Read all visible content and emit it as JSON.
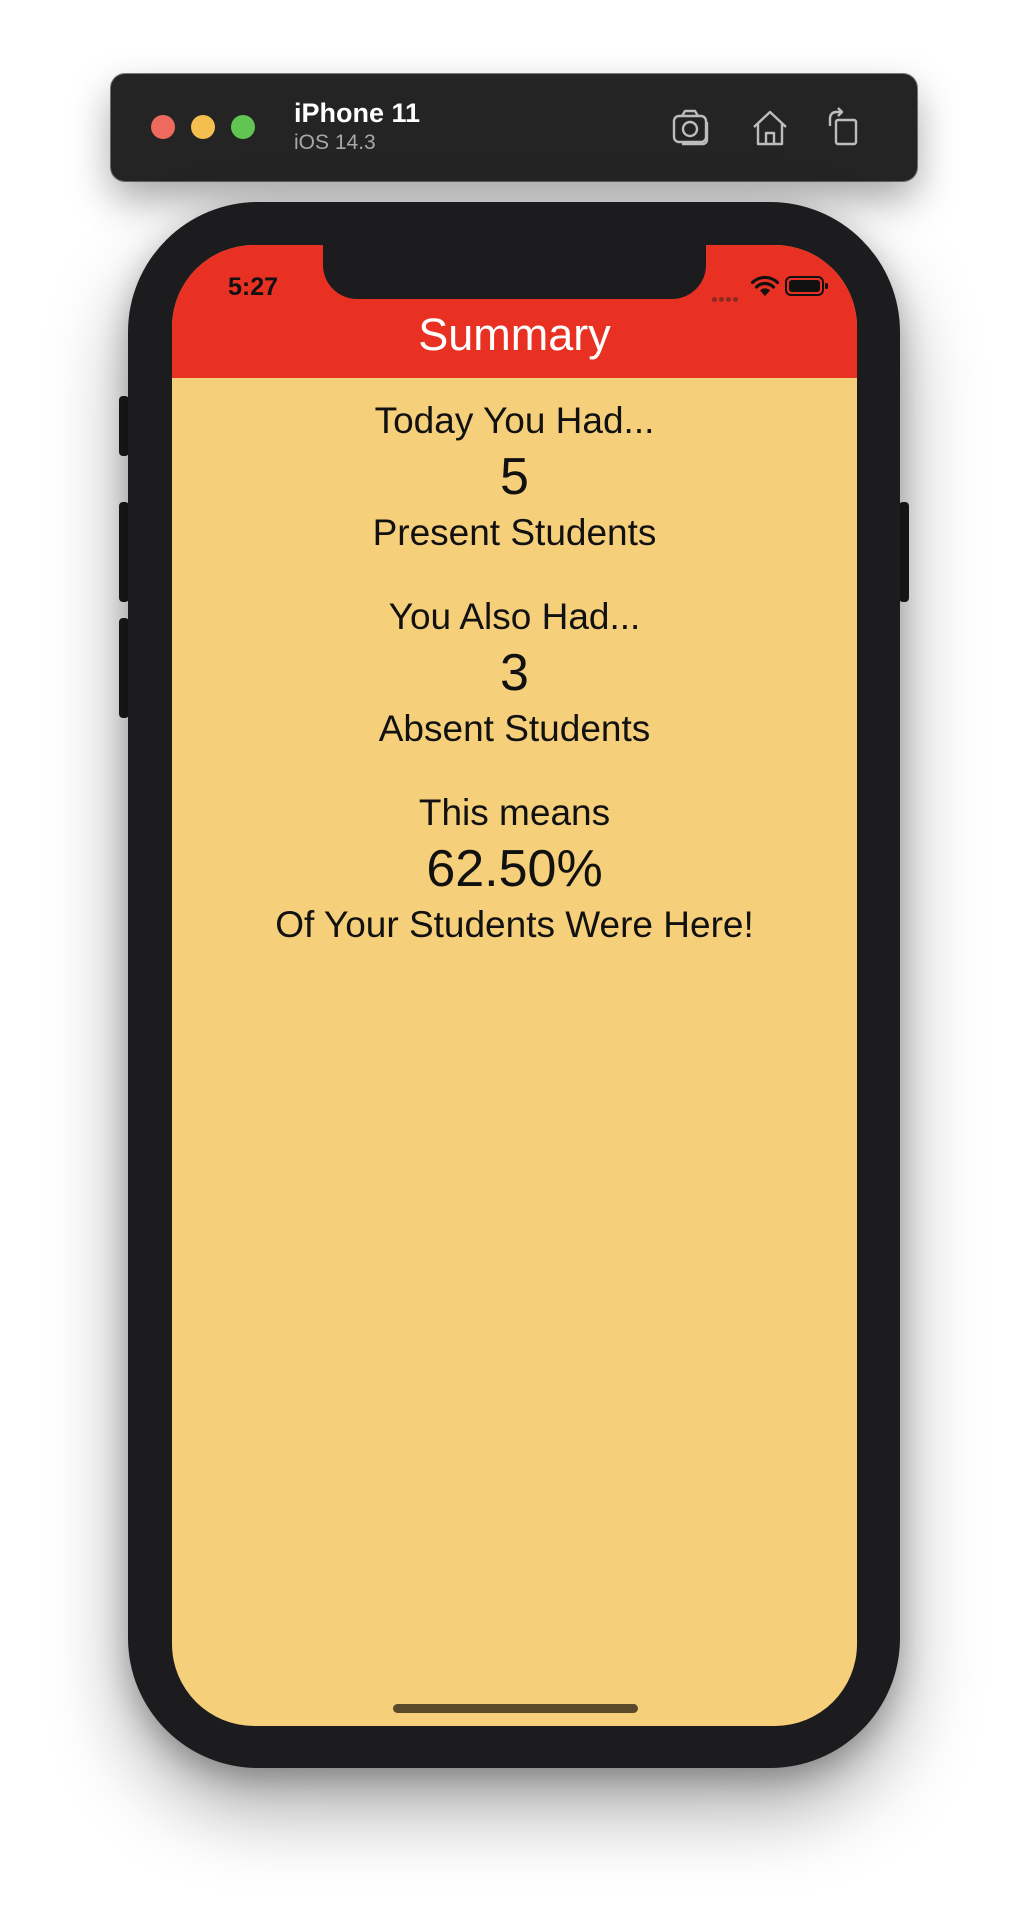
{
  "simulator": {
    "device_name": "iPhone 11",
    "os_version": "iOS 14.3",
    "icons": [
      "screenshot-icon",
      "home-icon",
      "rotate-icon"
    ]
  },
  "status_bar": {
    "time": "5:27",
    "icons": [
      "cellular-icon",
      "wifi-icon",
      "battery-icon"
    ]
  },
  "nav": {
    "title": "Summary",
    "color": "#e83122"
  },
  "summary": {
    "present": {
      "intro": "Today You Had...",
      "value": "5",
      "caption": "Present Students"
    },
    "absent": {
      "intro": "You Also Had...",
      "value": "3",
      "caption": "Absent Students"
    },
    "percentage": {
      "intro": "This means",
      "value": "62.50%",
      "caption": "Of Your Students Were Here!"
    }
  },
  "colors": {
    "background": "#f5cf7a",
    "nav_bar": "#e83122",
    "text": "#111111"
  }
}
